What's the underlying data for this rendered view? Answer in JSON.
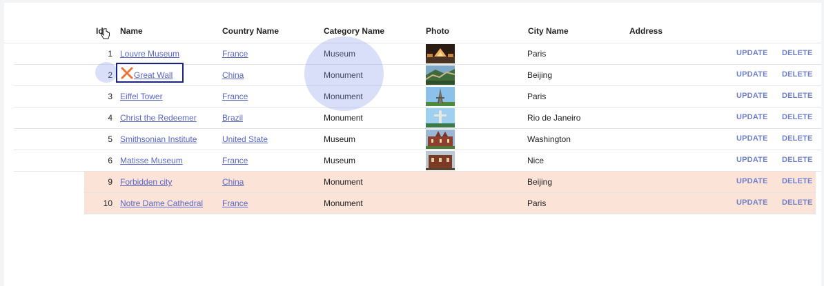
{
  "columns": {
    "id": "Id",
    "name": "Name",
    "country": "Country Name",
    "category": "Category Name",
    "photo": "Photo",
    "city": "City Name",
    "address": "Address"
  },
  "actions": {
    "update": "UPDATE",
    "delete": "DELETE"
  },
  "rows": [
    {
      "id": "1",
      "name": "Louvre Museum",
      "country": "France",
      "category": "Museum",
      "city": "Paris"
    },
    {
      "id": "2",
      "name": "Great Wall",
      "country": "China",
      "category": "Monument",
      "city": "Beijing"
    },
    {
      "id": "3",
      "name": "Eiffel Tower",
      "country": "France",
      "category": "Monument",
      "city": "Paris"
    },
    {
      "id": "4",
      "name": "Christ the Redeemer",
      "country": "Brazil",
      "category": "Monument",
      "city": "Rio de Janeiro"
    },
    {
      "id": "5",
      "name": "Smithsonian Institute",
      "country": "United State",
      "category": "Museum",
      "city": "Washington"
    },
    {
      "id": "6",
      "name": "Matisse Museum",
      "country": "France",
      "category": "Museum",
      "city": "Nice"
    },
    {
      "id": "9",
      "name": "Forbidden city",
      "country": "China",
      "category": "Monument",
      "city": "Beijing"
    },
    {
      "id": "10",
      "name": "Notre Dame Cathedral",
      "country": "France",
      "category": "Monument",
      "city": "Paris"
    }
  ],
  "colors": {
    "link": "#5a67c7",
    "highlight_row": "#fbe3d7",
    "action": "#7080c8",
    "focus_border": "#1a237e"
  }
}
